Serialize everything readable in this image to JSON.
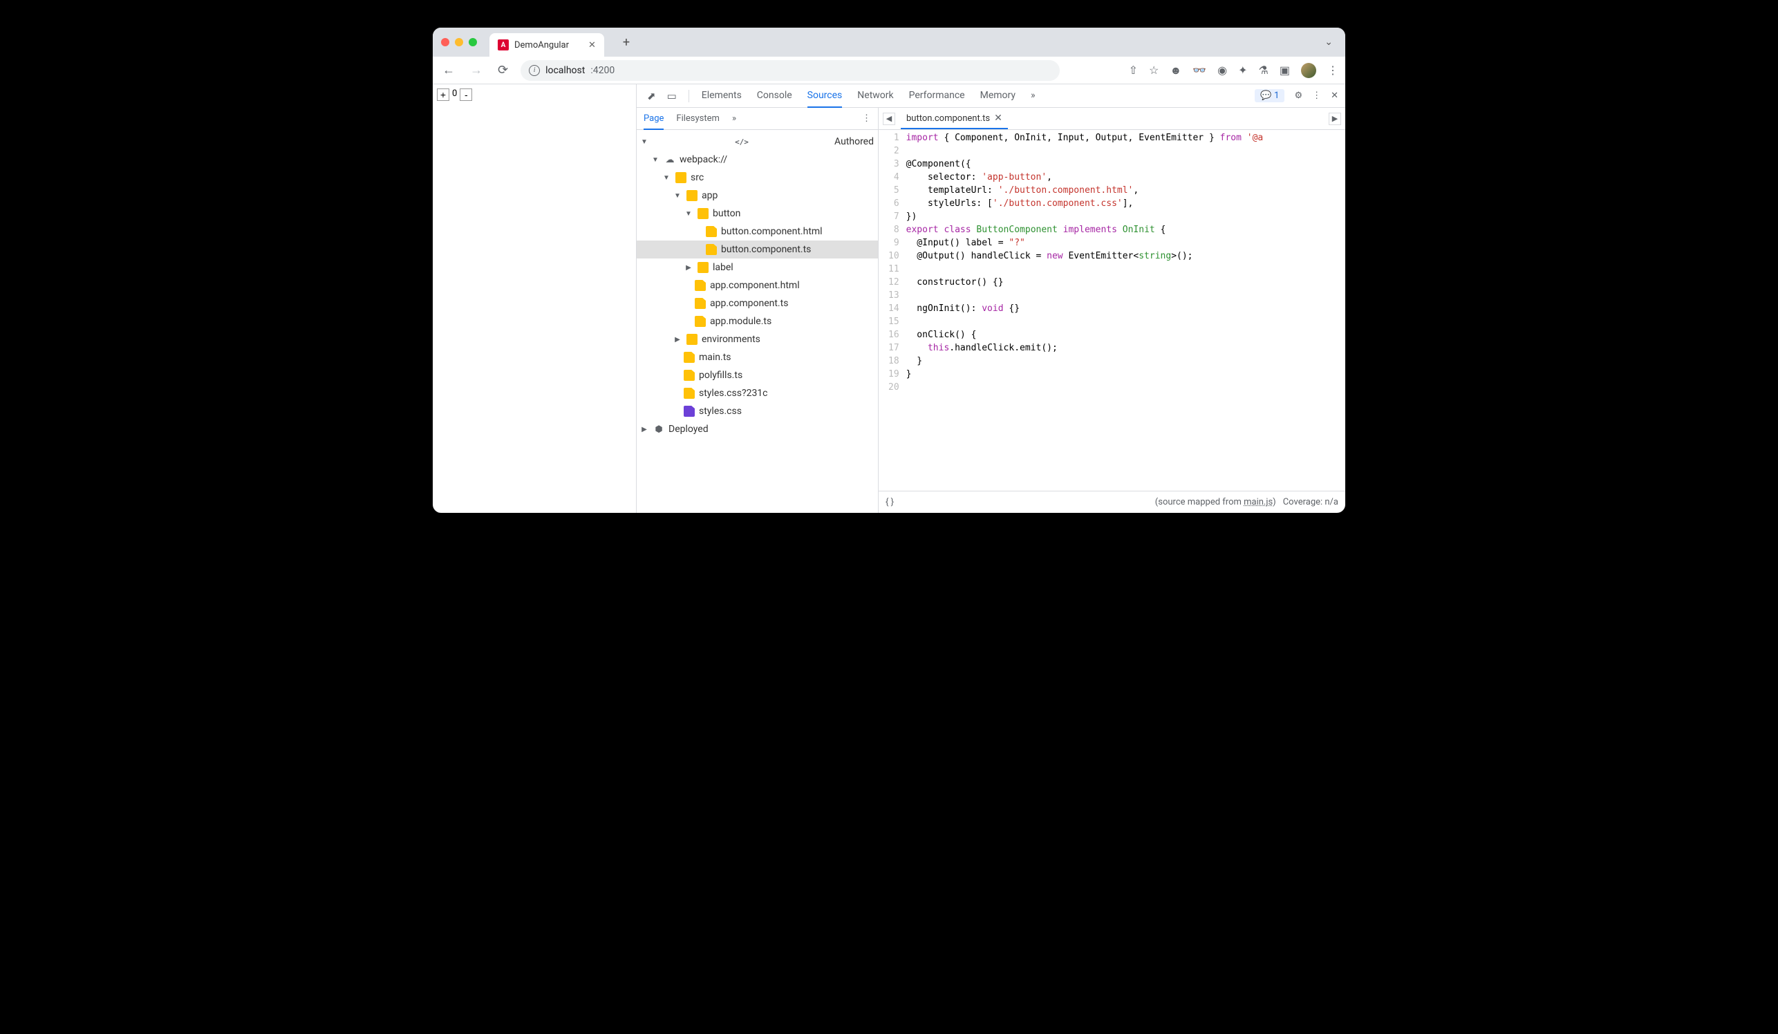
{
  "browser": {
    "tab_title": "DemoAngular",
    "url_host": "localhost",
    "url_port": ":4200"
  },
  "page": {
    "btn_plus": "+",
    "btn_val": "0",
    "btn_minus": "-"
  },
  "devtools": {
    "tabs": [
      "Elements",
      "Console",
      "Sources",
      "Network",
      "Performance",
      "Memory"
    ],
    "active_tab": "Sources",
    "issues_count": "1"
  },
  "nav": {
    "tabs": [
      "Page",
      "Filesystem"
    ],
    "active": "Page"
  },
  "tree": {
    "authored": "Authored",
    "webpack": "webpack://",
    "src": "src",
    "app": "app",
    "button": "button",
    "button_html": "button.component.html",
    "button_ts": "button.component.ts",
    "label": "label",
    "app_html": "app.component.html",
    "app_ts": "app.component.ts",
    "app_module": "app.module.ts",
    "env": "environments",
    "main": "main.ts",
    "polyfills": "polyfills.ts",
    "styles_q": "styles.css?231c",
    "styles": "styles.css",
    "deployed": "Deployed"
  },
  "editor": {
    "open_file": "button.component.ts",
    "line_count": 20
  },
  "code": {
    "l1": {
      "a": "import",
      "b": " { Component, OnInit, Input, Output, EventEmitter } ",
      "c": "from",
      "d": " '@a"
    },
    "l3": {
      "a": "@Component",
      "b": "({"
    },
    "l4": {
      "a": "    selector: ",
      "b": "'app-button'",
      "c": ","
    },
    "l5": {
      "a": "    templateUrl: ",
      "b": "'./button.component.html'",
      "c": ","
    },
    "l6": {
      "a": "    styleUrls: [",
      "b": "'./button.component.css'",
      "c": "],"
    },
    "l7": "})",
    "l8": {
      "a": "export",
      "b": " ",
      "c": "class",
      "d": " ",
      "e": "ButtonComponent",
      "f": " ",
      "g": "implements",
      "h": " ",
      "i": "OnInit",
      "j": " {"
    },
    "l9": {
      "a": "  @Input() label = ",
      "b": "\"?\""
    },
    "l10": {
      "a": "  @Output() handleClick = ",
      "b": "new",
      "c": " EventEmitter<",
      "d": "string",
      "e": ">();"
    },
    "l12": "  constructor() {}",
    "l14": {
      "a": "  ngOnInit(): ",
      "b": "void",
      "c": " {}"
    },
    "l16": "  onClick() {",
    "l17": {
      "a": "    ",
      "b": "this",
      "c": ".handleClick.emit();"
    },
    "l18": "  }",
    "l19": "}"
  },
  "footer": {
    "src_map_pre": "(source mapped from ",
    "src_map_link": "main.js",
    "src_map_post": ")",
    "coverage": "Coverage: n/a"
  }
}
